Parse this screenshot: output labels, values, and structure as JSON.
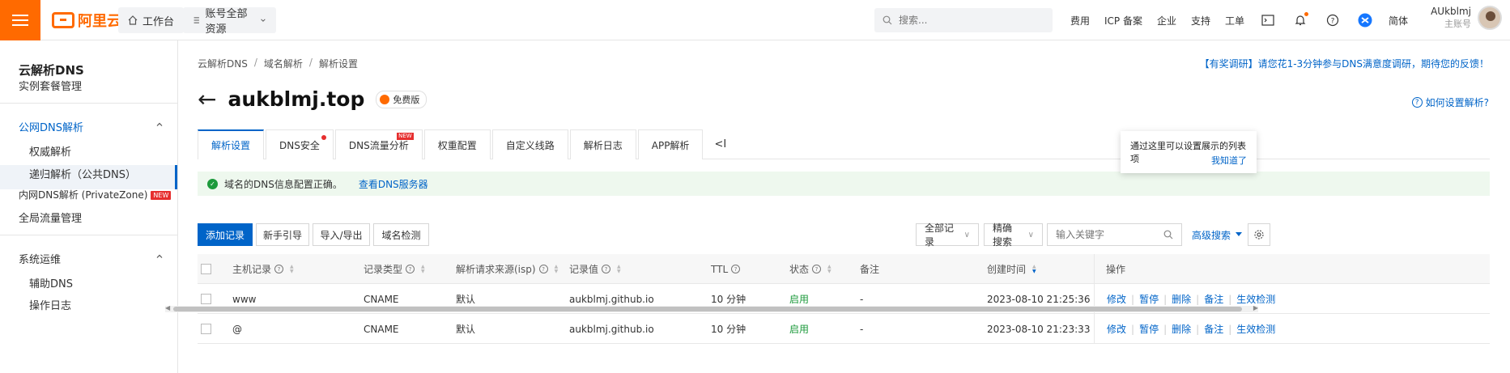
{
  "topbar": {
    "logo_text": "阿里云",
    "workbench": "工作台",
    "resource_scope": "账号全部资源",
    "search_placeholder": "搜索...",
    "links": [
      "费用",
      "ICP 备案",
      "企业",
      "支持",
      "工单"
    ],
    "lang": "简体",
    "user_name": "AUkblmj",
    "user_role": "主账号",
    "icons": [
      "terminal-icon",
      "bell-icon",
      "help-icon",
      "app-icon"
    ]
  },
  "sidebar": {
    "title": "云解析DNS",
    "instance": "实例套餐管理",
    "group_public": "公网DNS解析",
    "authoritative": "权威解析",
    "recursive": "递归解析（公共DNS）",
    "private": "内网DNS解析 (PrivateZone)",
    "private_badge": "NEW",
    "global_traffic": "全局流量管理",
    "group_ops": "系统运维",
    "aux_dns": "辅助DNS",
    "op_log": "操作日志"
  },
  "breadcrumb": [
    "云解析DNS",
    "域名解析",
    "解析设置"
  ],
  "survey": "【有奖调研】请您花1-3分钟参与DNS满意度调研，期待您的反馈！",
  "header": {
    "domain": "aukblmj.top",
    "edition": "免费版",
    "help": "如何设置解析?"
  },
  "tabs": [
    {
      "label": "解析设置",
      "active": true
    },
    {
      "label": "DNS安全",
      "dot": true
    },
    {
      "label": "DNS流量分析",
      "tag": "NEW"
    },
    {
      "label": "权重配置"
    },
    {
      "label": "自定义线路"
    },
    {
      "label": "解析日志"
    },
    {
      "label": "APP解析"
    }
  ],
  "tab_collapse": "<I",
  "alert": {
    "text": "域名的DNS信息配置正确。",
    "link": "查看DNS服务器"
  },
  "tooltip": {
    "text": "通过这里可以设置展示的列表项",
    "action": "我知道了"
  },
  "toolbar": {
    "add": "添加记录",
    "guide": "新手引导",
    "import_export": "导入/导出",
    "check": "域名检测",
    "record_filter": "全部记录",
    "search_mode": "精确搜索",
    "keyword_placeholder": "输入关键字",
    "advanced": "高级搜索"
  },
  "table": {
    "headers": {
      "host": "主机记录",
      "type": "记录类型",
      "isp": "解析请求来源(isp)",
      "value": "记录值",
      "ttl": "TTL",
      "status": "状态",
      "remark": "备注",
      "created": "创建时间",
      "ops": "操作"
    },
    "rows": [
      {
        "host": "www",
        "type": "CNAME",
        "isp": "默认",
        "value": "aukblmj.github.io",
        "ttl": "10 分钟",
        "status": "启用",
        "remark": "-",
        "created": "2023-08-10 21:25:36"
      },
      {
        "host": "@",
        "type": "CNAME",
        "isp": "默认",
        "value": "aukblmj.github.io",
        "ttl": "10 分钟",
        "status": "启用",
        "remark": "-",
        "created": "2023-08-10 21:23:33"
      }
    ],
    "ops": [
      "修改",
      "暂停",
      "删除",
      "备注",
      "生效检测"
    ]
  },
  "colors": {
    "brand": "#ff6a00",
    "primary": "#0064c8",
    "success": "#1d9a3c",
    "alert_bg": "#eef8ee"
  }
}
